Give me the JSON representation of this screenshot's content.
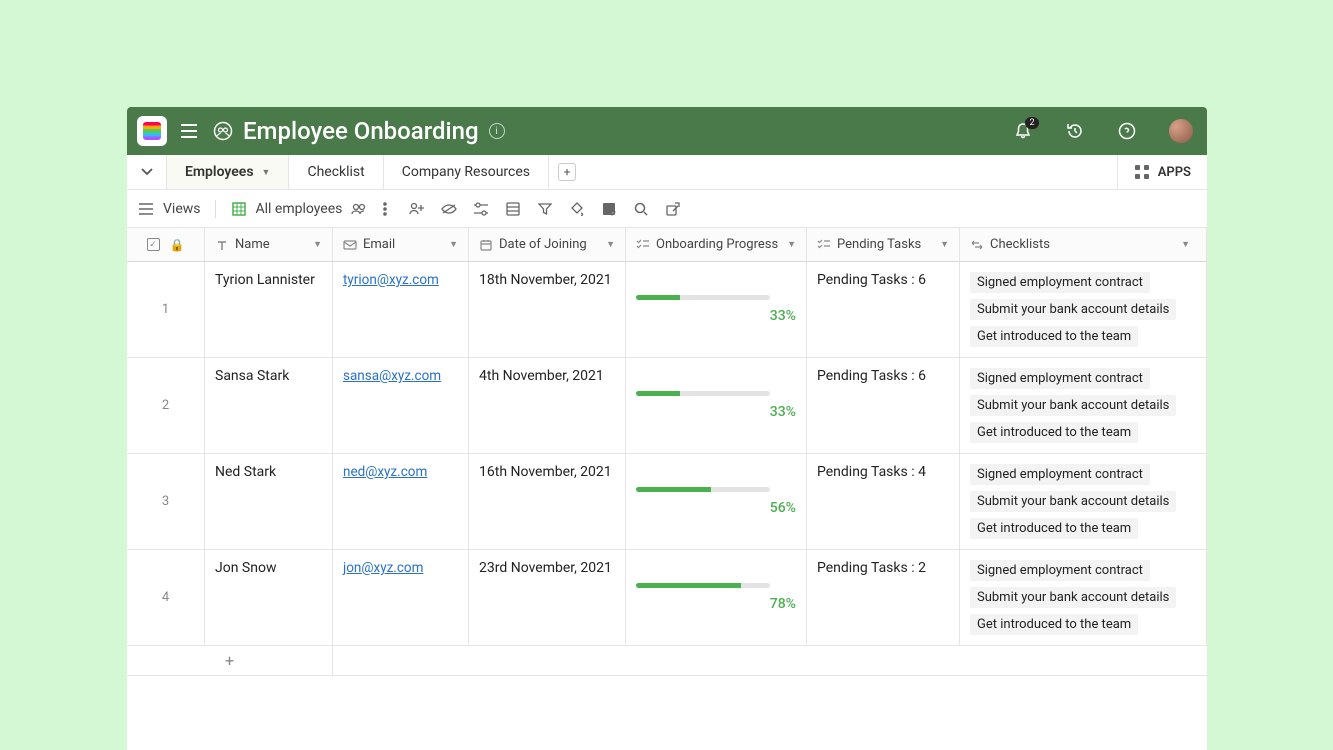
{
  "header": {
    "title": "Employee Onboarding",
    "notification_count": "2"
  },
  "tabs": {
    "items": [
      {
        "label": "Employees",
        "active": true,
        "has_dropdown": true
      },
      {
        "label": "Checklist",
        "active": false,
        "has_dropdown": false
      },
      {
        "label": "Company Resources",
        "active": false,
        "has_dropdown": false
      }
    ],
    "apps_label": "APPS"
  },
  "toolbar": {
    "views_label": "Views",
    "current_view": "All employees"
  },
  "columns": {
    "name": "Name",
    "email": "Email",
    "date": "Date of Joining",
    "progress": "Onboarding Progress",
    "tasks": "Pending Tasks",
    "checklists": "Checklists"
  },
  "rows": [
    {
      "idx": "1",
      "name": "Tyrion Lannister",
      "email": "tyrion@xyz.com",
      "date": "18th November, 2021",
      "progress_pct": 33,
      "progress_label": "33%",
      "pending": "Pending Tasks : 6",
      "checklists": [
        "Signed employment contract",
        "Submit your bank account details",
        "Get introduced to the team"
      ]
    },
    {
      "idx": "2",
      "name": "Sansa Stark",
      "email": "sansa@xyz.com",
      "date": "4th November, 2021",
      "progress_pct": 33,
      "progress_label": "33%",
      "pending": "Pending Tasks : 6",
      "checklists": [
        "Signed employment contract",
        "Submit your bank account details",
        "Get introduced to the team"
      ]
    },
    {
      "idx": "3",
      "name": "Ned Stark",
      "email": "ned@xyz.com",
      "date": "16th November, 2021",
      "progress_pct": 56,
      "progress_label": "56%",
      "pending": "Pending Tasks : 4",
      "checklists": [
        "Signed employment contract",
        "Submit your bank account details",
        "Get introduced to the team"
      ]
    },
    {
      "idx": "4",
      "name": "Jon Snow",
      "email": "jon@xyz.com",
      "date": "23rd November, 2021",
      "progress_pct": 78,
      "progress_label": "78%",
      "pending": "Pending Tasks : 2",
      "checklists": [
        "Signed employment contract",
        "Submit your bank account details",
        "Get introduced to the team"
      ]
    }
  ]
}
